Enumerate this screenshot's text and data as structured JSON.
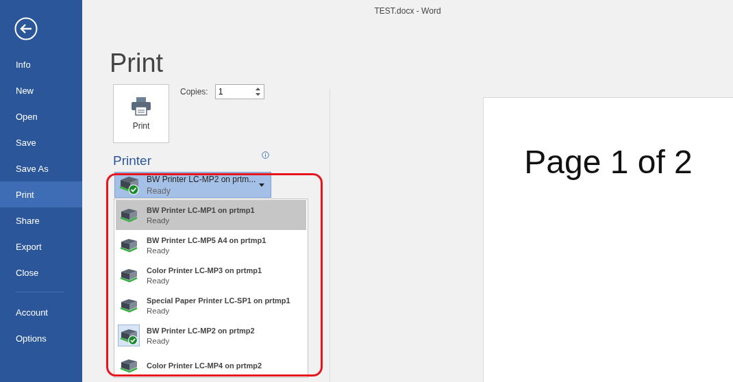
{
  "window": {
    "title": "TEST.docx - Word"
  },
  "sidebar": {
    "items": [
      {
        "label": "Info",
        "selected": false
      },
      {
        "label": "New",
        "selected": false
      },
      {
        "label": "Open",
        "selected": false
      },
      {
        "label": "Save",
        "selected": false
      },
      {
        "label": "Save As",
        "selected": false
      },
      {
        "label": "Print",
        "selected": true
      },
      {
        "label": "Share",
        "selected": false
      },
      {
        "label": "Export",
        "selected": false
      },
      {
        "label": "Close",
        "selected": false
      }
    ],
    "bottom_items": [
      {
        "label": "Account",
        "selected": false
      },
      {
        "label": "Options",
        "selected": false
      }
    ]
  },
  "heading": "Print",
  "print_button": {
    "label": "Print"
  },
  "copies": {
    "label": "Copies:",
    "value": "1"
  },
  "printer_section": {
    "heading": "Printer"
  },
  "printer_dropdown": {
    "name": "BW Printer LC-MP2 on prtm...",
    "status": "Ready",
    "default": true
  },
  "printer_list": [
    {
      "name": "BW Printer LC-MP1 on prtmp1",
      "status": "Ready",
      "hovered": true,
      "selected": false
    },
    {
      "name": "BW Printer LC-MP5 A4 on prtmp1",
      "status": "Ready",
      "hovered": false,
      "selected": false
    },
    {
      "name": "Color Printer LC-MP3 on prtmp1",
      "status": "Ready",
      "hovered": false,
      "selected": false
    },
    {
      "name": "Special Paper Printer LC-SP1 on prtmp1",
      "status": "Ready",
      "hovered": false,
      "selected": false
    },
    {
      "name": "BW Printer LC-MP2 on prtmp2",
      "status": "Ready",
      "hovered": false,
      "selected": true
    },
    {
      "name": "Color Printer LC-MP4 on prtmp2",
      "hovered": false,
      "selected": false
    }
  ],
  "preview": {
    "text": "Page 1 of 2"
  }
}
